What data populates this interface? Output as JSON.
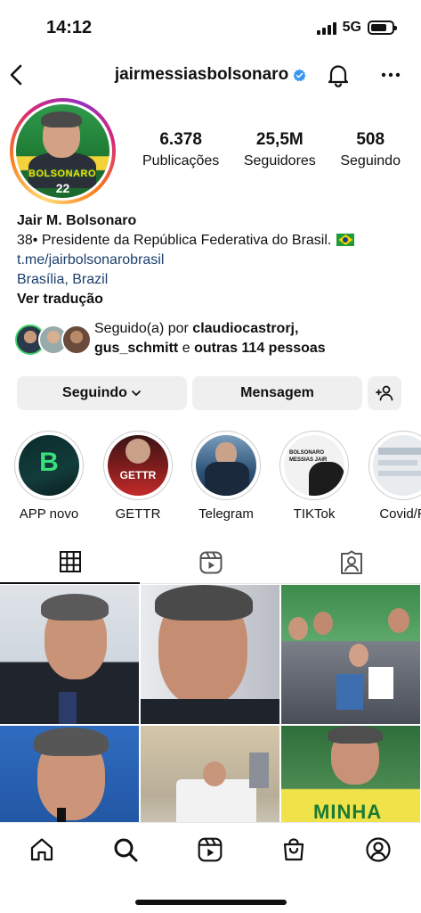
{
  "status": {
    "time": "14:12",
    "network": "5G",
    "battery_level": 0.75
  },
  "header": {
    "username": "jairmessiasbolsonaro",
    "back_icon": "chevron-left-icon",
    "bell_icon": "bell-icon",
    "more_icon": "more-icon"
  },
  "profile": {
    "avatar_text": "BOLSONARO",
    "avatar_number": "22",
    "stats": [
      {
        "value": "6.378",
        "label": "Publicações"
      },
      {
        "value": "25,5M",
        "label": "Seguidores"
      },
      {
        "value": "508",
        "label": "Seguindo"
      }
    ],
    "name": "Jair M. Bolsonaro",
    "bio": "38• Presidente da República Federativa do Brasil.",
    "link": "t.me/jairbolsonarobrasil",
    "location": "Brasília, Brazil",
    "translate": "Ver tradução"
  },
  "followed_by": {
    "prefix": "Seguido(a) por",
    "user1": "claudiocastrorj,",
    "user2": "gus_schmitt",
    "connector": "e",
    "others": "outras 114 pessoas"
  },
  "buttons": {
    "following": "Seguindo",
    "message": "Mensagem"
  },
  "highlights": [
    {
      "label": "APP novo",
      "img_text": "B"
    },
    {
      "label": "GETTR",
      "img_text": "GETTR"
    },
    {
      "label": "Telegram",
      "img_text": ""
    },
    {
      "label": "TIKTok",
      "img_text": "BOLSONARO MESSIAS JAIR"
    },
    {
      "label": "Covid/R",
      "img_text": ""
    }
  ],
  "tabs": [
    {
      "name": "grid",
      "icon": "grid-icon"
    },
    {
      "name": "reels",
      "icon": "reels-icon"
    },
    {
      "name": "tagged",
      "icon": "tagged-icon"
    }
  ],
  "posts": [
    {
      "text": ""
    },
    {
      "text": ""
    },
    {
      "text": ""
    },
    {
      "text": ""
    },
    {
      "text": ""
    },
    {
      "text": "MINHA"
    }
  ],
  "nav": [
    "home-icon",
    "search-icon",
    "reels-icon",
    "shop-icon",
    "profile-icon"
  ],
  "colors": {
    "link": "#1b3f6b",
    "verified": "#3897f0",
    "button_bg": "#efefef"
  }
}
